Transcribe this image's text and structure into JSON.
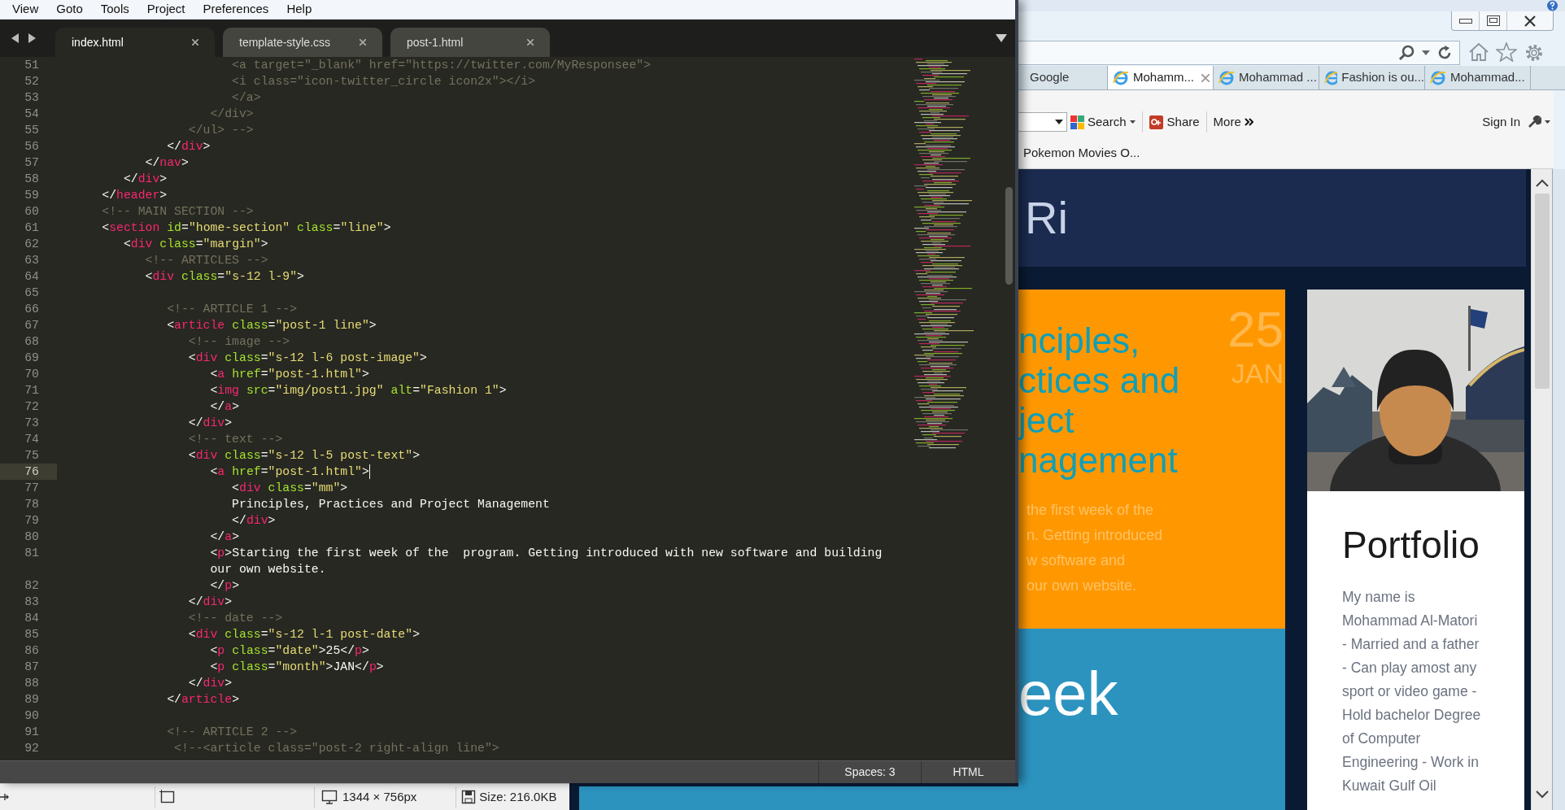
{
  "editor": {
    "menu": [
      "View",
      "Goto",
      "Tools",
      "Project",
      "Preferences",
      "Help"
    ],
    "tabs": [
      {
        "label": "index.html",
        "selected": true
      },
      {
        "label": "template-style.css",
        "selected": false
      },
      {
        "label": "post-1.html",
        "selected": false
      }
    ],
    "lines": [
      {
        "number": "51",
        "current": false,
        "tokens": [
          {
            "kind": "com",
            "text": "                        <a target=\"_blank\" href=\"https://twitter.com/MyResponsee\">"
          }
        ]
      },
      {
        "number": "52",
        "current": false,
        "tokens": [
          {
            "kind": "com",
            "text": "                        <i class=\"icon-twitter_circle icon2x\"></i>"
          }
        ]
      },
      {
        "number": "53",
        "current": false,
        "tokens": [
          {
            "kind": "com",
            "text": "                        </a>"
          }
        ]
      },
      {
        "number": "54",
        "current": false,
        "tokens": [
          {
            "kind": "com",
            "text": "                     </div>"
          }
        ]
      },
      {
        "number": "55",
        "current": false,
        "tokens": [
          {
            "kind": "com",
            "text": "                  </ul> -->"
          }
        ]
      },
      {
        "number": "56",
        "current": false,
        "tokens": [
          {
            "kind": "p",
            "text": "               </"
          },
          {
            "kind": "tag",
            "text": "div"
          },
          {
            "kind": "p",
            "text": ">"
          }
        ]
      },
      {
        "number": "57",
        "current": false,
        "tokens": [
          {
            "kind": "p",
            "text": "            </"
          },
          {
            "kind": "tag",
            "text": "nav"
          },
          {
            "kind": "p",
            "text": ">"
          }
        ]
      },
      {
        "number": "58",
        "current": false,
        "tokens": [
          {
            "kind": "p",
            "text": "         </"
          },
          {
            "kind": "tag",
            "text": "div"
          },
          {
            "kind": "p",
            "text": ">"
          }
        ]
      },
      {
        "number": "59",
        "current": false,
        "tokens": [
          {
            "kind": "p",
            "text": "      </"
          },
          {
            "kind": "tag",
            "text": "header"
          },
          {
            "kind": "p",
            "text": ">"
          }
        ]
      },
      {
        "number": "60",
        "current": false,
        "tokens": [
          {
            "kind": "com",
            "text": "      <!-- MAIN SECTION -->"
          }
        ]
      },
      {
        "number": "61",
        "current": false,
        "tokens": [
          {
            "kind": "p",
            "text": "      <"
          },
          {
            "kind": "tag",
            "text": "section"
          },
          {
            "kind": "attr",
            "text": " id"
          },
          {
            "kind": "p",
            "text": "="
          },
          {
            "kind": "str",
            "text": "\"home-section\""
          },
          {
            "kind": "attr",
            "text": " class"
          },
          {
            "kind": "p",
            "text": "="
          },
          {
            "kind": "str",
            "text": "\"line\""
          },
          {
            "kind": "p",
            "text": ">"
          }
        ]
      },
      {
        "number": "62",
        "current": false,
        "tokens": [
          {
            "kind": "p",
            "text": "         <"
          },
          {
            "kind": "tag",
            "text": "div"
          },
          {
            "kind": "attr",
            "text": " class"
          },
          {
            "kind": "p",
            "text": "="
          },
          {
            "kind": "str",
            "text": "\"margin\""
          },
          {
            "kind": "p",
            "text": ">"
          }
        ]
      },
      {
        "number": "63",
        "current": false,
        "tokens": [
          {
            "kind": "com",
            "text": "            <!-- ARTICLES -->"
          }
        ]
      },
      {
        "number": "64",
        "current": false,
        "tokens": [
          {
            "kind": "p",
            "text": "            <"
          },
          {
            "kind": "tag",
            "text": "div"
          },
          {
            "kind": "attr",
            "text": " class"
          },
          {
            "kind": "p",
            "text": "="
          },
          {
            "kind": "str",
            "text": "\"s-12 l-9\""
          },
          {
            "kind": "p",
            "text": ">"
          }
        ]
      },
      {
        "number": "65",
        "current": false
      },
      {
        "number": "66",
        "current": false,
        "tokens": [
          {
            "kind": "com",
            "text": "               <!-- ARTICLE 1 -->"
          }
        ]
      },
      {
        "number": "67",
        "current": false,
        "tokens": [
          {
            "kind": "p",
            "text": "               <"
          },
          {
            "kind": "tag",
            "text": "article"
          },
          {
            "kind": "attr",
            "text": " class"
          },
          {
            "kind": "p",
            "text": "="
          },
          {
            "kind": "str",
            "text": "\"post-1 line\""
          },
          {
            "kind": "p",
            "text": ">"
          }
        ]
      },
      {
        "number": "68",
        "current": false,
        "tokens": [
          {
            "kind": "com",
            "text": "                  <!-- image -->"
          }
        ]
      },
      {
        "number": "69",
        "current": false,
        "tokens": [
          {
            "kind": "p",
            "text": "                  <"
          },
          {
            "kind": "tag",
            "text": "div"
          },
          {
            "kind": "attr",
            "text": " class"
          },
          {
            "kind": "p",
            "text": "="
          },
          {
            "kind": "str",
            "text": "\"s-12 l-6 post-image\""
          },
          {
            "kind": "p",
            "text": ">"
          }
        ]
      },
      {
        "number": "70",
        "current": false,
        "tokens": [
          {
            "kind": "p",
            "text": "                     <"
          },
          {
            "kind": "tag",
            "text": "a"
          },
          {
            "kind": "attr",
            "text": " href"
          },
          {
            "kind": "p",
            "text": "="
          },
          {
            "kind": "str",
            "text": "\"post-1.html\""
          },
          {
            "kind": "p",
            "text": ">"
          }
        ]
      },
      {
        "number": "71",
        "current": false,
        "tokens": [
          {
            "kind": "p",
            "text": "                     <"
          },
          {
            "kind": "tag",
            "text": "img"
          },
          {
            "kind": "attr",
            "text": " src"
          },
          {
            "kind": "p",
            "text": "="
          },
          {
            "kind": "str",
            "text": "\"img/post1.jpg\""
          },
          {
            "kind": "attr",
            "text": " alt"
          },
          {
            "kind": "p",
            "text": "="
          },
          {
            "kind": "str",
            "text": "\"Fashion 1\""
          },
          {
            "kind": "p",
            "text": ">"
          }
        ]
      },
      {
        "number": "72",
        "current": false,
        "tokens": [
          {
            "kind": "p",
            "text": "                     </"
          },
          {
            "kind": "tag",
            "text": "a"
          },
          {
            "kind": "p",
            "text": ">"
          }
        ]
      },
      {
        "number": "73",
        "current": false,
        "tokens": [
          {
            "kind": "p",
            "text": "                  </"
          },
          {
            "kind": "tag",
            "text": "div"
          },
          {
            "kind": "p",
            "text": ">"
          }
        ]
      },
      {
        "number": "74",
        "current": false,
        "tokens": [
          {
            "kind": "com",
            "text": "                  <!-- text -->"
          }
        ]
      },
      {
        "number": "75",
        "current": false,
        "tokens": [
          {
            "kind": "p",
            "text": "                  <"
          },
          {
            "kind": "tag",
            "text": "div"
          },
          {
            "kind": "attr",
            "text": " class"
          },
          {
            "kind": "p",
            "text": "="
          },
          {
            "kind": "str",
            "text": "\"s-12 l-5 post-text\""
          },
          {
            "kind": "p",
            "text": ">"
          }
        ]
      },
      {
        "number": "76",
        "current": true,
        "tokens": [
          {
            "kind": "p",
            "text": "                     <"
          },
          {
            "kind": "tag",
            "text": "a"
          },
          {
            "kind": "attr",
            "text": " href"
          },
          {
            "kind": "p",
            "text": "="
          },
          {
            "kind": "str",
            "text": "\"post-1.html\""
          },
          {
            "kind": "p",
            "text": ">"
          }
        ]
      },
      {
        "number": "77",
        "current": false,
        "tokens": [
          {
            "kind": "p",
            "text": "                        <"
          },
          {
            "kind": "tag",
            "text": "div"
          },
          {
            "kind": "attr",
            "text": " class"
          },
          {
            "kind": "p",
            "text": "="
          },
          {
            "kind": "str",
            "text": "\"mm\""
          },
          {
            "kind": "p",
            "text": ">"
          }
        ]
      },
      {
        "number": "78",
        "current": false,
        "tokens": [
          {
            "kind": "p",
            "text": "                        Principles, Practices and Project Management"
          }
        ]
      },
      {
        "number": "79",
        "current": false,
        "tokens": [
          {
            "kind": "p",
            "text": "                        </"
          },
          {
            "kind": "tag",
            "text": "div"
          },
          {
            "kind": "p",
            "text": ">"
          }
        ]
      },
      {
        "number": "80",
        "current": false,
        "tokens": [
          {
            "kind": "p",
            "text": "                     </"
          },
          {
            "kind": "tag",
            "text": "a"
          },
          {
            "kind": "p",
            "text": ">"
          }
        ]
      },
      {
        "number": "81",
        "current": false,
        "tokens": [
          {
            "kind": "p",
            "text": "                     <"
          },
          {
            "kind": "tag",
            "text": "p"
          },
          {
            "kind": "p",
            "text": ">Starting the first week of the  program. Getting introduced with new software and building"
          }
        ]
      },
      {
        "current": false,
        "tokens": [
          {
            "kind": "p",
            "text": "                     our own website."
          }
        ]
      },
      {
        "number": "82",
        "current": false,
        "tokens": [
          {
            "kind": "p",
            "text": "                     </"
          },
          {
            "kind": "tag",
            "text": "p"
          },
          {
            "kind": "p",
            "text": ">"
          }
        ]
      },
      {
        "number": "83",
        "current": false,
        "tokens": [
          {
            "kind": "p",
            "text": "                  </"
          },
          {
            "kind": "tag",
            "text": "div"
          },
          {
            "kind": "p",
            "text": ">"
          }
        ]
      },
      {
        "number": "84",
        "current": false,
        "tokens": [
          {
            "kind": "com",
            "text": "                  <!-- date -->"
          }
        ]
      },
      {
        "number": "85",
        "current": false,
        "tokens": [
          {
            "kind": "p",
            "text": "                  <"
          },
          {
            "kind": "tag",
            "text": "div"
          },
          {
            "kind": "attr",
            "text": " class"
          },
          {
            "kind": "p",
            "text": "="
          },
          {
            "kind": "str",
            "text": "\"s-12 l-1 post-date\""
          },
          {
            "kind": "p",
            "text": ">"
          }
        ]
      },
      {
        "number": "86",
        "current": false,
        "tokens": [
          {
            "kind": "p",
            "text": "                     <"
          },
          {
            "kind": "tag",
            "text": "p"
          },
          {
            "kind": "attr",
            "text": " class"
          },
          {
            "kind": "p",
            "text": "="
          },
          {
            "kind": "str",
            "text": "\"date\""
          },
          {
            "kind": "p",
            "text": ">25</"
          },
          {
            "kind": "tag",
            "text": "p"
          },
          {
            "kind": "p",
            "text": ">"
          }
        ]
      },
      {
        "number": "87",
        "current": false,
        "tokens": [
          {
            "kind": "p",
            "text": "                     <"
          },
          {
            "kind": "tag",
            "text": "p"
          },
          {
            "kind": "attr",
            "text": " class"
          },
          {
            "kind": "p",
            "text": "="
          },
          {
            "kind": "str",
            "text": "\"month\""
          },
          {
            "kind": "p",
            "text": ">JAN</"
          },
          {
            "kind": "tag",
            "text": "p"
          },
          {
            "kind": "p",
            "text": ">"
          }
        ]
      },
      {
        "number": "88",
        "current": false,
        "tokens": [
          {
            "kind": "p",
            "text": "                  </"
          },
          {
            "kind": "tag",
            "text": "div"
          },
          {
            "kind": "p",
            "text": ">"
          }
        ]
      },
      {
        "number": "89",
        "current": false,
        "tokens": [
          {
            "kind": "p",
            "text": "               </"
          },
          {
            "kind": "tag",
            "text": "article"
          },
          {
            "kind": "p",
            "text": ">"
          }
        ]
      },
      {
        "number": "90",
        "current": false
      },
      {
        "number": "91",
        "current": false,
        "tokens": [
          {
            "kind": "com",
            "text": "               <!-- ARTICLE 2 -->"
          }
        ]
      },
      {
        "number": "92",
        "current": false,
        "tokens": [
          {
            "kind": "com",
            "text": "                <!--<article class=\"post-2 right-align line\">"
          }
        ]
      }
    ],
    "status_bar": {
      "indentation": "Spaces: 3",
      "syntax": "HTML"
    }
  },
  "image_viewer_status": {
    "dimensions": "1344 × 756px",
    "size": "Size: 216.0KB"
  },
  "browser": {
    "tabs": [
      {
        "label": "Google",
        "selected": false
      },
      {
        "label": "Mohamm...",
        "selected": true
      },
      {
        "label": "Mohammad ...",
        "selected": false
      },
      {
        "label": "Fashion is ou...",
        "selected": false
      },
      {
        "label": "Mohammad...",
        "selected": false
      }
    ],
    "toolbar": {
      "search": "Search",
      "share": "Share",
      "more": "More",
      "sign_in": "Sign In"
    },
    "favorites": [
      "Pokemon Movies O..."
    ],
    "page": {
      "header_text": "Ri",
      "post": {
        "title_lines": [
          "nciples,",
          "ctices and",
          "ject",
          "nagement"
        ],
        "day": "25",
        "month": "JAN",
        "excerpt_lines": [
          "the first week of the",
          "n. Getting introduced",
          "w software and",
          "our own website."
        ]
      },
      "next_post_title": "eek",
      "portfolio": {
        "title": "Portfolio",
        "text_lines": [
          "My name is",
          "Mohammad Al-Matori",
          "- Married and a father",
          "- Can play amost any",
          "sport or video game -",
          "Hold bachelor Degree",
          "of Computer",
          "Engineering - Work in",
          "Kuwait Gulf Oil"
        ]
      }
    }
  }
}
